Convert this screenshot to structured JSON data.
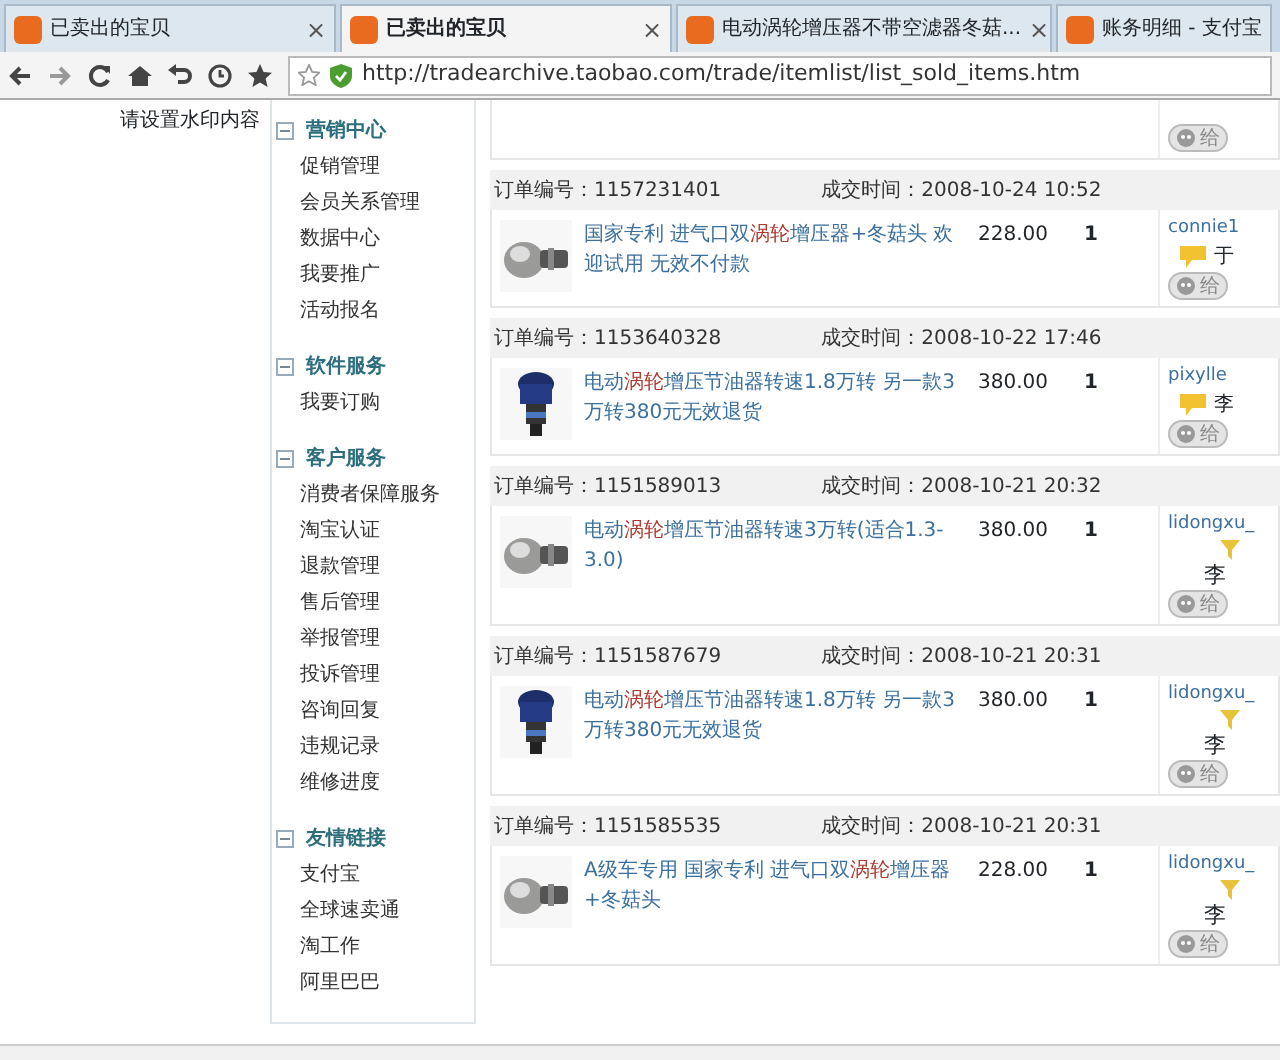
{
  "tabs": [
    {
      "label": "已卖出的宝贝",
      "selected": false,
      "close": "×"
    },
    {
      "label": "已卖出的宝贝",
      "selected": true,
      "close": "×"
    },
    {
      "label": "电动涡轮增压器不带空滤器冬菇...",
      "selected": false,
      "close": "×"
    },
    {
      "label": "账务明细 - 支付宝",
      "selected": false
    }
  ],
  "address_bar": {
    "url": "http://tradearchive.taobao.com/trade/itemlist/list_sold_items.htm"
  },
  "watermark_text": "请设置水印内容",
  "sidebar": {
    "sections": [
      {
        "title": "营销中心",
        "expanded": true,
        "items": [
          "促销管理",
          "会员关系管理",
          "数据中心",
          "我要推广",
          "活动报名"
        ]
      },
      {
        "title": "软件服务",
        "expanded": true,
        "items": [
          "我要订购"
        ]
      },
      {
        "title": "客户服务",
        "expanded": true,
        "items": [
          "消费者保障服务",
          "淘宝认证",
          "退款管理",
          "售后管理",
          "举报管理",
          "投诉管理",
          "咨询回复",
          "违规记录",
          "维修进度"
        ]
      },
      {
        "title": "友情链接",
        "expanded": true,
        "items": [
          "支付宝",
          "全球速卖通",
          "淘工作",
          "阿里巴巴"
        ]
      }
    ]
  },
  "top_partial_order": {
    "chat": "给"
  },
  "orders": [
    {
      "order_label": "订单编号：",
      "order_no": "1157231401",
      "time_label": "成交时间：",
      "time": "2008-10-24 10:52",
      "title": [
        {
          "text": "国家专利 进气口双",
          "highlight": false
        },
        {
          "text": "涡轮",
          "highlight": true
        },
        {
          "text": "增压器+冬菇头 欢迎试用 无效不付款",
          "highlight": false
        }
      ],
      "price": "228.00",
      "qty": "1",
      "buyer": "connie1",
      "note": {
        "kind": "memo",
        "text": "于"
      },
      "chat": "给"
    },
    {
      "order_label": "订单编号：",
      "order_no": "1153640328",
      "time_label": "成交时间：",
      "time": "2008-10-22 17:46",
      "title": [
        {
          "text": "电动",
          "highlight": false
        },
        {
          "text": "涡轮",
          "highlight": true
        },
        {
          "text": "增压节油器转速1.8万转 另一款3万转380元无效退货",
          "highlight": false
        }
      ],
      "price": "380.00",
      "qty": "1",
      "buyer": "pixylle",
      "note": {
        "kind": "memo",
        "text": "李"
      },
      "chat": "给"
    },
    {
      "order_label": "订单编号：",
      "order_no": "1151589013",
      "time_label": "成交时间：",
      "time": "2008-10-21 20:32",
      "title": [
        {
          "text": "电动",
          "highlight": false
        },
        {
          "text": "涡轮",
          "highlight": true
        },
        {
          "text": "增压节油器转速3万转(适合1.3-3.0)",
          "highlight": false
        }
      ],
      "price": "380.00",
      "qty": "1",
      "buyer": "lidongxu_",
      "note": {
        "kind": "flag",
        "text": "李"
      },
      "chat": "给"
    },
    {
      "order_label": "订单编号：",
      "order_no": "1151587679",
      "time_label": "成交时间：",
      "time": "2008-10-21 20:31",
      "title": [
        {
          "text": "电动",
          "highlight": false
        },
        {
          "text": "涡轮",
          "highlight": true
        },
        {
          "text": "增压节油器转速1.8万转 另一款3万转380元无效退货",
          "highlight": false
        }
      ],
      "price": "380.00",
      "qty": "1",
      "buyer": "lidongxu_",
      "note": {
        "kind": "flag",
        "text": "李"
      },
      "chat": "给"
    },
    {
      "order_label": "订单编号：",
      "order_no": "1151585535",
      "time_label": "成交时间：",
      "time": "2008-10-21 20:31",
      "title": [
        {
          "text": "A级车专用 国家专利 进气口双",
          "highlight": false
        },
        {
          "text": "涡轮",
          "highlight": true
        },
        {
          "text": "增压器+冬菇头",
          "highlight": false
        }
      ],
      "price": "228.00",
      "qty": "1",
      "buyer": "lidongxu_",
      "note": {
        "kind": "flag",
        "text": "李"
      },
      "chat": "给"
    }
  ]
}
